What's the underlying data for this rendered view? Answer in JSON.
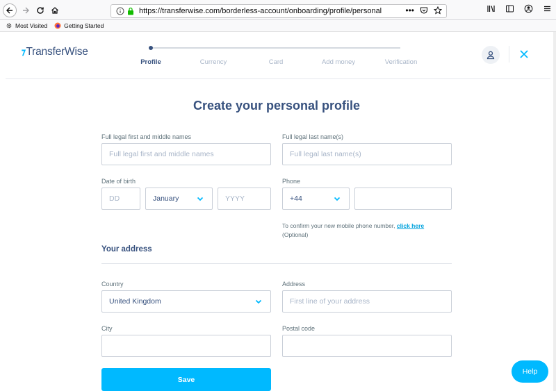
{
  "browser": {
    "url": "https://transferwise.com/borderless-account/onboarding/profile/personal",
    "bookmarks": [
      "Most Visited",
      "Getting Started"
    ]
  },
  "site": {
    "logo_text": "TransferWise",
    "steps": [
      "Profile",
      "Currency",
      "Card",
      "Add money",
      "Verification"
    ],
    "active_step": "Profile"
  },
  "form": {
    "title": "Create your personal profile",
    "first_names_label": "Full legal first and middle names",
    "first_names_placeholder": "Full legal first and middle names",
    "last_name_label": "Full legal last name(s)",
    "last_name_placeholder": "Full legal last name(s)",
    "dob_label": "Date of birth",
    "dob_day_placeholder": "DD",
    "dob_month_value": "January",
    "dob_year_placeholder": "YYYY",
    "phone_label": "Phone",
    "phone_code_value": "+44",
    "phone_number_value": "",
    "phone_helper_text": "To confirm your new mobile phone number, ",
    "phone_helper_link": "click here",
    "phone_helper_optional": "(Optional)",
    "address_section_title": "Your address",
    "country_label": "Country",
    "country_value": "United Kingdom",
    "address_label": "Address",
    "address_placeholder": "First line of your address",
    "city_label": "City",
    "city_value": "",
    "postal_label": "Postal code",
    "postal_value": "",
    "save_label": "Save"
  },
  "help": {
    "label": "Help"
  },
  "colors": {
    "brand": "#00b9ff",
    "navy": "#37517e",
    "muted": "#a8b5c8"
  }
}
